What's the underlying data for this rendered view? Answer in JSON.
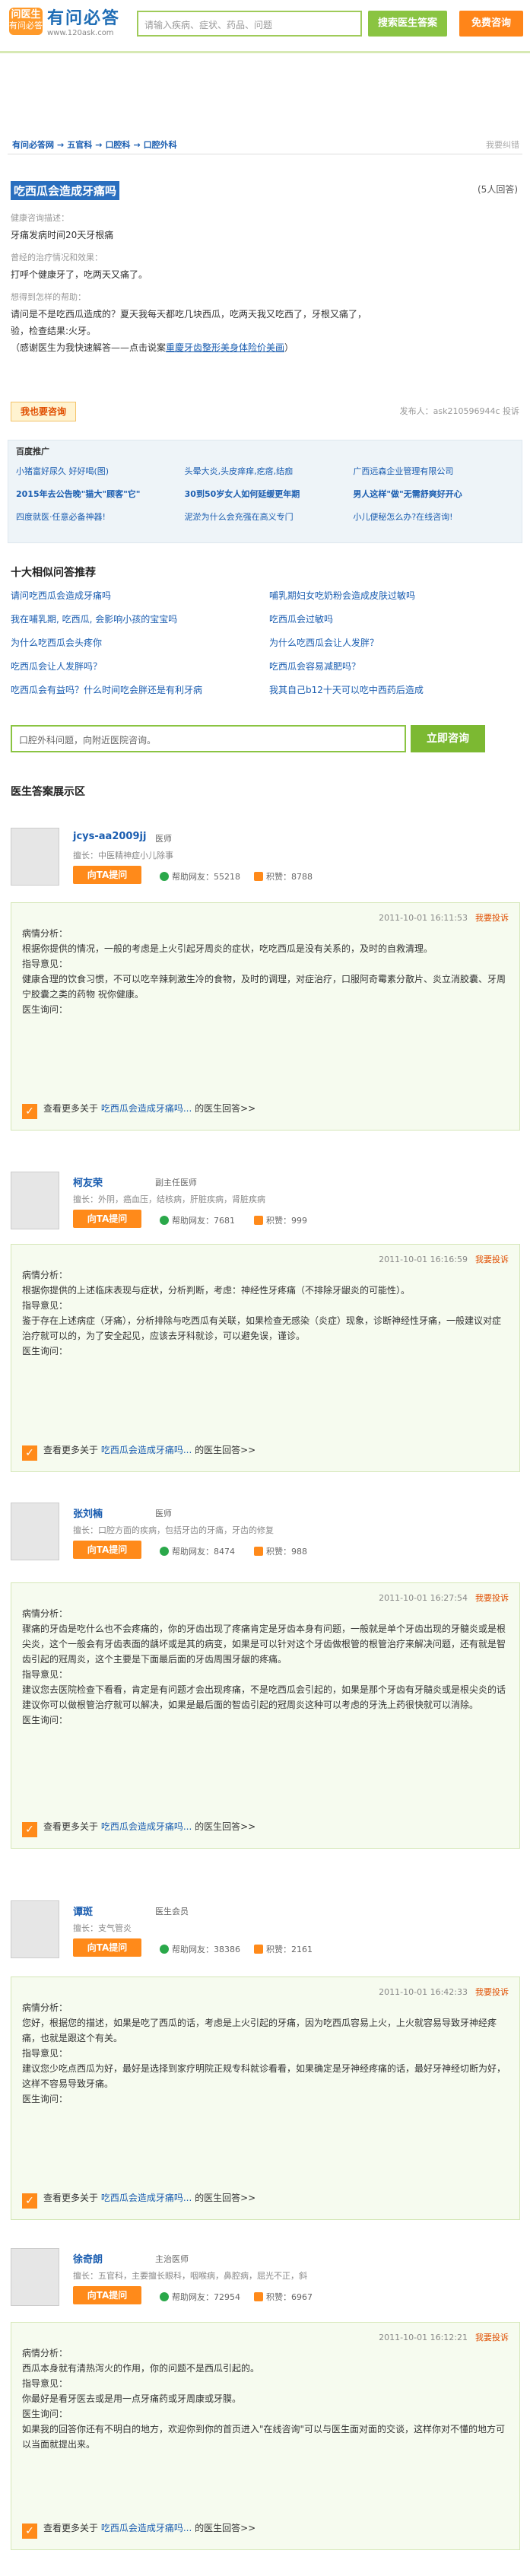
{
  "header": {
    "logo_badge_top": "问医生",
    "logo_badge_bottom": "有问必答",
    "logo_title": "有问必答",
    "logo_url": "www.120ask.com",
    "search_placeholder": "请输入疾病、症状、药品、问题",
    "search_button": "搜索医生答案",
    "consult_button": "免费咨询"
  },
  "breadcrumb": [
    "有问必答网",
    "五官科",
    "口腔科",
    "口腔外科"
  ],
  "report_link": "我要纠错",
  "question": {
    "title": "吃西瓜会造成牙痛吗",
    "answer_count": "(5人回答)",
    "label_desc": "健康咨询描述：",
    "desc": "牙痛发病时间20天牙根痛",
    "label_treat": "曾经的治疗情况和效果：",
    "treat": "打呼个健康牙了，吃两天又痛了。",
    "label_help": "想得到怎样的帮助：",
    "help_line1": "请问是不是吃西瓜造成的？夏天我每天都吃几块西瓜，吃两天我又吃西了，牙根又痛了，",
    "help_line2": "验，检查结果:火牙。",
    "help_line3_prefix": "（感谢医生为我快速解答——点击说案",
    "help_line3_link": "重慶牙齿整形美身体险价美画",
    "help_line3_suffix": "）",
    "ask_button": "我也要咨询",
    "meta": "发布人：ask210596944c 投诉"
  },
  "ads": {
    "title": "百度推广",
    "items": [
      {
        "text": "小猪富好尿久 好好喝(图)",
        "bold": false
      },
      {
        "text": "头晕大炎,头皮痒痒,疙瘩,结痂",
        "bold": false
      },
      {
        "text": "广西远森企业管理有限公司",
        "bold": false
      },
      {
        "text": "2015年去公告晚\"猫大\"顾客\"它\"",
        "bold": true
      },
      {
        "text": "30到50岁女人如何延缓更年期",
        "bold": true
      },
      {
        "text": "男人这样\"做\"无需舒爽好开心",
        "bold": true
      },
      {
        "text": "四度就医·任意必备神器!",
        "bold": false
      },
      {
        "text": "泥淤为什么会充强在高义专门",
        "bold": false
      },
      {
        "text": "小儿便秘怎么办?在线咨询!",
        "bold": false
      }
    ]
  },
  "related": {
    "title": "十大相似问答推荐",
    "items": [
      "请问吃西瓜会造成牙痛吗",
      "哺乳期妇女吃奶粉会造成皮肤过敏吗",
      "我在哺乳期, 吃西瓜, 会影响小孩的宝宝吗",
      "吃西瓜会过敏吗",
      "为什么吃西瓜会头疼你",
      "为什么吃西瓜会让人发胖？",
      "吃西瓜会让人发胖吗？",
      "吃西瓜会容易减肥吗？",
      "吃西瓜会有益吗？什么时间吃会胖还是有利牙病",
      "我其自己b12十天可以吃中西药后造成"
    ]
  },
  "ask_box": {
    "placeholder": "口腔外科问题，向附近医院咨询。",
    "button": "立即咨询"
  },
  "answers_title": "医生答案展示区",
  "doctors": [
    {
      "name": "jcys-aa2009jj",
      "title": "医师",
      "spec": "擅长：中医精神症小儿除事",
      "ask": "向TA提问",
      "help": "帮助网友：55218",
      "score": "积赞：8788",
      "time": "2011-10-01 16:11:53",
      "report": "我要投诉",
      "l1": "病情分析：",
      "b1": "根据你提供的情况，一般的考虑是上火引起牙周炎的症状，吃吃西瓜是没有关系的，及时的自救清理。",
      "l2": "指导意见：",
      "b2": "健康合理的饮食习惯，不可以吃辛辣刺激生冷的食物，及时的调理，对症治疗，口服阿奇霉素分散片、炎立消胶囊、牙周宁胶囊之类的药物 祝你健康。",
      "l3": "医生询问：",
      "more_prefix": "查看更多关于",
      "more_link": "吃西瓜会造成牙痛吗...",
      "more_suffix": "的医生回答>>"
    },
    {
      "name": "柯友荣",
      "title": "副主任医师",
      "spec": "擅长：外阴，癌血压，结核病，肝脏疾病，肾脏疾病",
      "ask": "向TA提问",
      "help": "帮助网友：7681",
      "score": "积赞：999",
      "time": "2011-10-01 16:16:59",
      "report": "我要投诉",
      "l1": "病情分析：",
      "b1": "根据你提供的上述临床表现与症状，分析判断，考虑：神经性牙疼痛（不排除牙龈炎的可能性）。",
      "l2": "指导意见：",
      "b2": "鉴于存在上述病症（牙痛），分析排除与吃西瓜有关联，如果检查无感染（炎症）现象，诊断神经性牙痛，一般建议对症治疗就可以的，为了安全起见，应该去牙科就诊，可以避免误，谨诊。",
      "l3": "医生询问：",
      "more_prefix": "查看更多关于",
      "more_link": "吃西瓜会造成牙痛吗...",
      "more_suffix": "的医生回答>>"
    },
    {
      "name": "张刘楠",
      "title": "医师",
      "spec": "擅长：口腔方面的疾病，包括牙齿的牙痛，牙齿的修复",
      "ask": "向TA提问",
      "help": "帮助网友：8474",
      "score": "积赞：988",
      "time": "2011-10-01 16:27:54",
      "report": "我要投诉",
      "l1": "病情分析：",
      "b1": "骤痛的牙齿是吃什么也不会疼痛的，你的牙齿出现了疼痛肯定是牙齿本身有问题，一般就是单个牙齿出现的牙髓炎或是根尖炎，这个一般会有牙齿表面的龋坏或是其的病变，如果是可以针对这个牙齿做根管的根管治疗来解决问题，还有就是智齿引起的冠周炎，这个主要是下面最后面的牙齿周围牙龈的疼痛。",
      "l2": "指导意见：",
      "b2": "建议您去医院检查下看看，肯定是有问题才会出现疼痛，不是吃西瓜会引起的，如果是那个牙齿有牙髓炎或是根尖炎的话建议你可以做根管治疗就可以解决，如果是最后面的智齿引起的冠周炎这种可以考虑的牙洗上药很快就可以消除。",
      "l3": "医生询问：",
      "more_prefix": "查看更多关于",
      "more_link": "吃西瓜会造成牙痛吗...",
      "more_suffix": "的医生回答>>"
    },
    {
      "name": "谭斑",
      "title": "医生会员",
      "spec": "擅长：支气管炎",
      "ask": "向TA提问",
      "help": "帮助网友：38386",
      "score": "积赞：2161",
      "time": "2011-10-01 16:42:33",
      "report": "我要投诉",
      "l1": "病情分析：",
      "b1": "您好，根据您的描述，如果是吃了西瓜的话，考虑是上火引起的牙痛，因为吃西瓜容易上火，上火就容易导致牙神经疼痛，也就是跟这个有关。",
      "l2": "指导意见：",
      "b2": "建议您少吃点西瓜为好，最好是选择到家疗明院正规专科就诊看看，如果确定是牙神经疼痛的话，最好牙神经切断为好，这样不容易导致牙痛。",
      "l3": "医生询问：",
      "more_prefix": "查看更多关于",
      "more_link": "吃西瓜会造成牙痛吗...",
      "more_suffix": "的医生回答>>"
    },
    {
      "name": "徐奇朗",
      "title": "主治医师",
      "spec": "擅长：五官科，主要擅长眼科，咽喉病，鼻腔病，屈光不正，斜",
      "ask": "向TA提问",
      "help": "帮助网友：72954",
      "score": "积赞：6967",
      "time": "2011-10-01 16:12:21",
      "report": "我要投诉",
      "l1": "病情分析：",
      "b1": "西瓜本身就有清热泻火的作用，你的问题不是西瓜引起的。",
      "l2": "指导意见：",
      "b2": "你最好是看牙医去或是用一点牙痛药或牙周康或牙膜。",
      "l3": "医生询问：",
      "b3": "如果我的回答你还有不明白的地方，欢迎你到你的首页进入\"在线咨询\"可以与医生面对面的交谈，这样你对不懂的地方可以当面就提出来。",
      "more_prefix": "查看更多关于",
      "more_link": "吃西瓜会造成牙痛吗...",
      "more_suffix": "的医生回答>>"
    }
  ]
}
